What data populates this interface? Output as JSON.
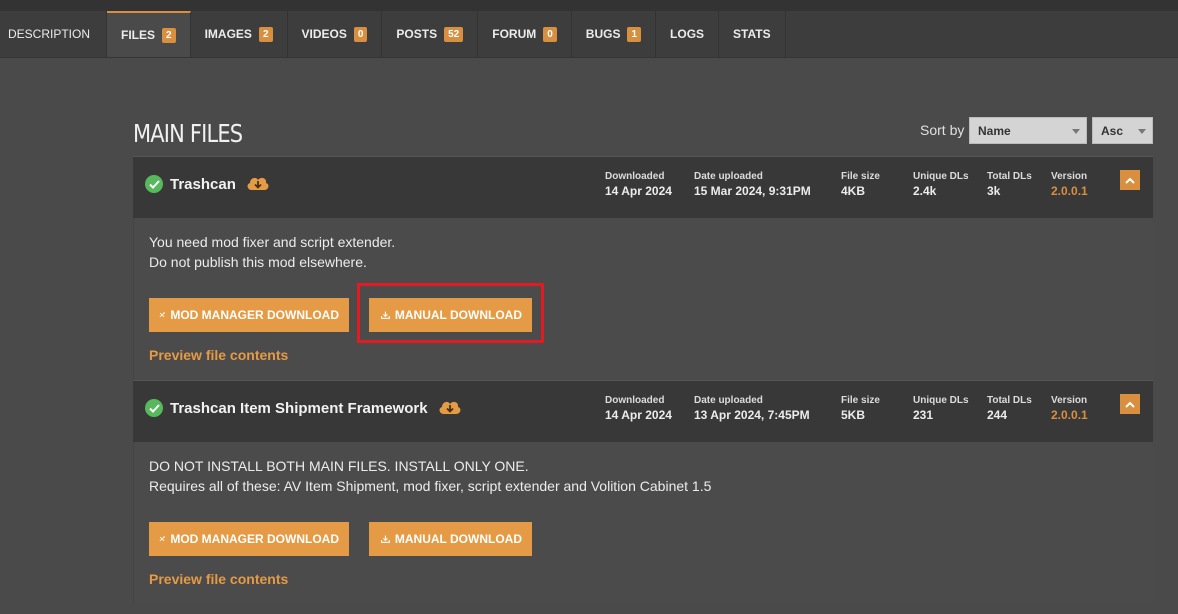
{
  "tabs": [
    {
      "label": "DESCRIPTION",
      "badge": null
    },
    {
      "label": "FILES",
      "badge": "2"
    },
    {
      "label": "IMAGES",
      "badge": "2"
    },
    {
      "label": "VIDEOS",
      "badge": "0"
    },
    {
      "label": "POSTS",
      "badge": "52"
    },
    {
      "label": "FORUM",
      "badge": "0"
    },
    {
      "label": "BUGS",
      "badge": "1"
    },
    {
      "label": "LOGS",
      "badge": null
    },
    {
      "label": "STATS",
      "badge": null
    }
  ],
  "active_tab": "FILES",
  "section": {
    "title": "MAIN FILES",
    "sort_label": "Sort by",
    "sort_field": "Name",
    "sort_order": "Asc"
  },
  "stat_labels": {
    "downloaded": "Downloaded",
    "uploaded": "Date uploaded",
    "size": "File size",
    "unique": "Unique DLs",
    "total": "Total DLs",
    "version": "Version"
  },
  "files": [
    {
      "name": "Trashcan",
      "downloaded": "14 Apr 2024",
      "uploaded": "15 Mar 2024, 9:31PM",
      "size": "4KB",
      "unique": "2.4k",
      "total": "3k",
      "version": "2.0.0.1",
      "desc_line1": "You need mod fixer and script extender.",
      "desc_line2": "Do not publish this mod elsewhere."
    },
    {
      "name": "Trashcan Item Shipment Framework",
      "downloaded": "14 Apr 2024",
      "uploaded": "13 Apr 2024, 7:45PM",
      "size": "5KB",
      "unique": "231",
      "total": "244",
      "version": "2.0.0.1",
      "desc_line1": "DO NOT INSTALL BOTH MAIN FILES. INSTALL ONLY ONE.",
      "desc_line2": "Requires all of these: AV Item Shipment, mod fixer, script extender and Volition Cabinet 1.5"
    }
  ],
  "buttons": {
    "mod_manager": "MOD MANAGER DOWNLOAD",
    "manual": "MANUAL DOWNLOAD",
    "preview": "Preview file contents"
  },
  "colors": {
    "accent": "#e59a45",
    "highlight": "#e01b24",
    "check": "#58b85c"
  }
}
